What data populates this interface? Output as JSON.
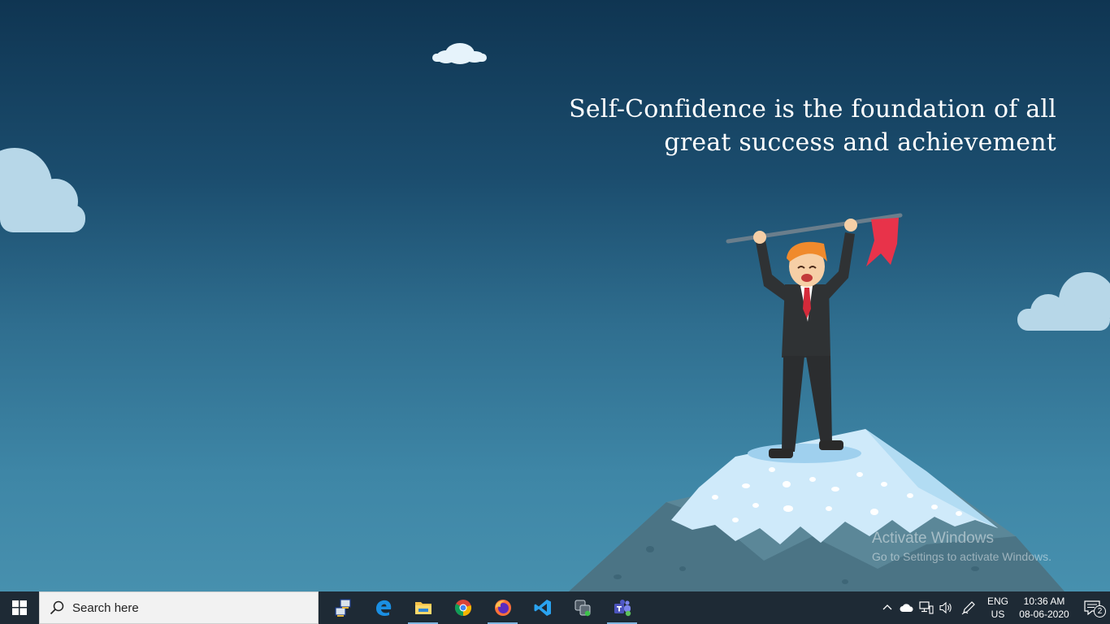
{
  "wallpaper": {
    "quote_line1": "Self-Confidence is the foundation of all",
    "quote_line2": "great success and achievement"
  },
  "watermark": {
    "title": "Activate Windows",
    "subtitle": "Go to Settings to activate Windows."
  },
  "taskbar": {
    "search_placeholder": "Search here",
    "apps": [
      "network-app-icon",
      "edge-icon",
      "file-explorer-icon",
      "chrome-icon",
      "firefox-icon",
      "vscode-icon",
      "vpn-app-icon",
      "teams-icon"
    ],
    "language_line1": "ENG",
    "language_line2": "US",
    "time": "10:36 AM",
    "date": "08-06-2020",
    "notification_count": "2"
  },
  "colors": {
    "taskbar_bg": "#1e2a35",
    "flag": "#e8334a",
    "snow": "#cfeafa"
  }
}
